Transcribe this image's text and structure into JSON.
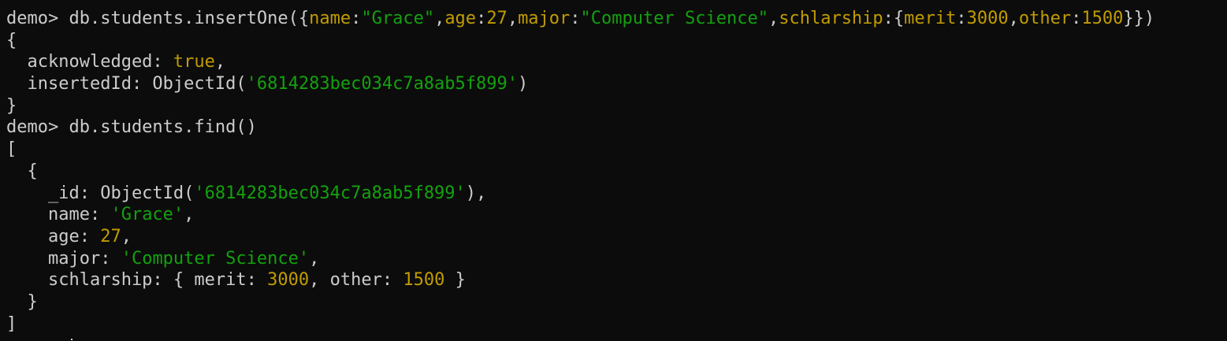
{
  "terminal": {
    "lines": [
      [
        {
          "t": "demo> db.students.insertOne({",
          "c": "default"
        },
        {
          "t": "name",
          "c": "key"
        },
        {
          "t": ":",
          "c": "default"
        },
        {
          "t": "\"Grace\"",
          "c": "str"
        },
        {
          "t": ",",
          "c": "default"
        },
        {
          "t": "age",
          "c": "key"
        },
        {
          "t": ":",
          "c": "default"
        },
        {
          "t": "27",
          "c": "num"
        },
        {
          "t": ",",
          "c": "default"
        },
        {
          "t": "major",
          "c": "key"
        },
        {
          "t": ":",
          "c": "default"
        },
        {
          "t": "\"Computer Science\"",
          "c": "str"
        },
        {
          "t": ",",
          "c": "default"
        },
        {
          "t": "schlarship",
          "c": "key"
        },
        {
          "t": ":{",
          "c": "default"
        },
        {
          "t": "merit",
          "c": "key"
        },
        {
          "t": ":",
          "c": "default"
        },
        {
          "t": "3000",
          "c": "num"
        },
        {
          "t": ",",
          "c": "default"
        },
        {
          "t": "other",
          "c": "key"
        },
        {
          "t": ":",
          "c": "default"
        },
        {
          "t": "1500",
          "c": "num"
        },
        {
          "t": "}})",
          "c": "default"
        }
      ],
      [
        {
          "t": "{",
          "c": "default"
        }
      ],
      [
        {
          "t": "  acknowledged: ",
          "c": "default"
        },
        {
          "t": "true",
          "c": "bool"
        },
        {
          "t": ",",
          "c": "default"
        }
      ],
      [
        {
          "t": "  insertedId: ObjectId(",
          "c": "default"
        },
        {
          "t": "'6814283bec034c7a8ab5f899'",
          "c": "str"
        },
        {
          "t": ")",
          "c": "default"
        }
      ],
      [
        {
          "t": "}",
          "c": "default"
        }
      ],
      [
        {
          "t": "demo> db.students.find()",
          "c": "default"
        }
      ],
      [
        {
          "t": "[",
          "c": "default"
        }
      ],
      [
        {
          "t": "  {",
          "c": "default"
        }
      ],
      [
        {
          "t": "    _id: ObjectId(",
          "c": "default"
        },
        {
          "t": "'6814283bec034c7a8ab5f899'",
          "c": "str"
        },
        {
          "t": "),",
          "c": "default"
        }
      ],
      [
        {
          "t": "    name: ",
          "c": "default"
        },
        {
          "t": "'Grace'",
          "c": "str"
        },
        {
          "t": ",",
          "c": "default"
        }
      ],
      [
        {
          "t": "    age: ",
          "c": "default"
        },
        {
          "t": "27",
          "c": "num"
        },
        {
          "t": ",",
          "c": "default"
        }
      ],
      [
        {
          "t": "    major: ",
          "c": "default"
        },
        {
          "t": "'Computer Science'",
          "c": "str"
        },
        {
          "t": ",",
          "c": "default"
        }
      ],
      [
        {
          "t": "    schlarship: { merit: ",
          "c": "default"
        },
        {
          "t": "3000",
          "c": "num"
        },
        {
          "t": ", other: ",
          "c": "default"
        },
        {
          "t": "1500",
          "c": "num"
        },
        {
          "t": " }",
          "c": "default"
        }
      ],
      [
        {
          "t": "  }",
          "c": "default"
        }
      ],
      [
        {
          "t": "]",
          "c": "default"
        }
      ]
    ]
  },
  "colors": {
    "background": "#0c0c0c",
    "foreground": "#cccccc",
    "string": "#13a10e",
    "number": "#c19c00"
  }
}
